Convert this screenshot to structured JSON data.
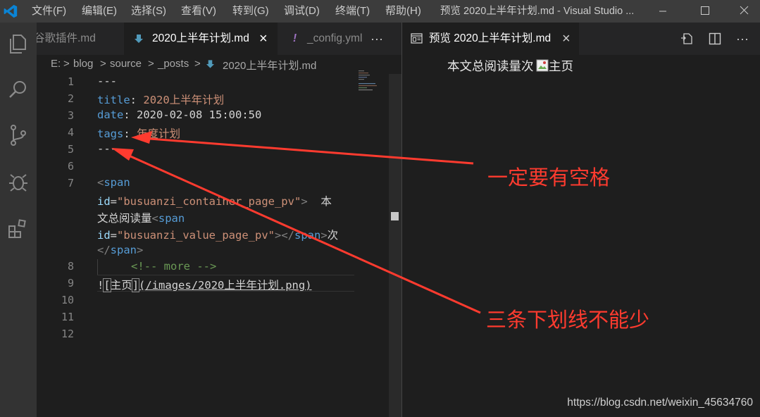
{
  "menu": {
    "file": "文件(F)",
    "edit": "编辑(E)",
    "selection": "选择(S)",
    "view": "查看(V)",
    "goto": "转到(G)",
    "debug": "调试(D)",
    "terminal": "终端(T)",
    "help": "帮助(H)"
  },
  "window_title": "预览 2020上半年计划.md - Visual Studio ...",
  "tabs": [
    {
      "label": "谷歌插件.md"
    },
    {
      "label": "2020上半年计划.md",
      "close": "×"
    },
    {
      "label": "_config.yml",
      "marker": "!"
    }
  ],
  "tab_overflow": "···",
  "breadcrumb": {
    "drive": "E:",
    "sep": ">",
    "blog": "blog",
    "source": "source",
    "posts": "_posts",
    "file": "2020上半年计划.md"
  },
  "line_numbers": [
    "1",
    "2",
    "3",
    "4",
    "5",
    "6",
    "7",
    "8",
    "9",
    "10",
    "11",
    "12"
  ],
  "code": {
    "l1": "---",
    "l2_key": "title",
    "l2_colon": ":",
    "l2_val": "2020上半年计划",
    "l3_key": "date",
    "l3_colon": ":",
    "l3_val": "2020-02-08 15:00:50",
    "l4_key": "tags",
    "l4_colon": ":",
    "l4_val": "年度计划",
    "l5": "---",
    "l7a_open": "<",
    "l7a_tag": "span",
    "l7b_attr": "id",
    "l7b_eq": "=",
    "l7b_val": "\"busuanzi_container_page_pv\"",
    "l7b_close": ">",
    "l7b_text": "  本",
    "l7c_text": "文总阅读量",
    "l7c_open": "<",
    "l7c_tag": "span",
    "l7d_attr": "id",
    "l7d_eq": "=",
    "l7d_val": "\"busuanzi_value_page_pv\"",
    "l7d_close": "></",
    "l7d_tag": "span",
    "l7d_end": ">",
    "l7d_text": "次",
    "l7e_open": "</",
    "l7e_tag": "span",
    "l7e_end": ">",
    "l8": "<!-- more -->",
    "l9_bang": "!",
    "l9_lb": "[",
    "l9_alt": "主页",
    "l9_rb": "]",
    "l9_path": "(/images/2020上半年计划.png)"
  },
  "preview": {
    "tab_label": "预览 2020上半年计划.md",
    "tab_close": "×",
    "content_text": "本文总阅读量次",
    "image_alt": "主页"
  },
  "annotations": {
    "note1": "一定要有空格",
    "note2": "三条下划线不能少"
  },
  "watermark": "https://blog.csdn.net/weixin_45634760",
  "colors": {
    "accent": "#007acc",
    "annotation": "#ff3b2f"
  }
}
